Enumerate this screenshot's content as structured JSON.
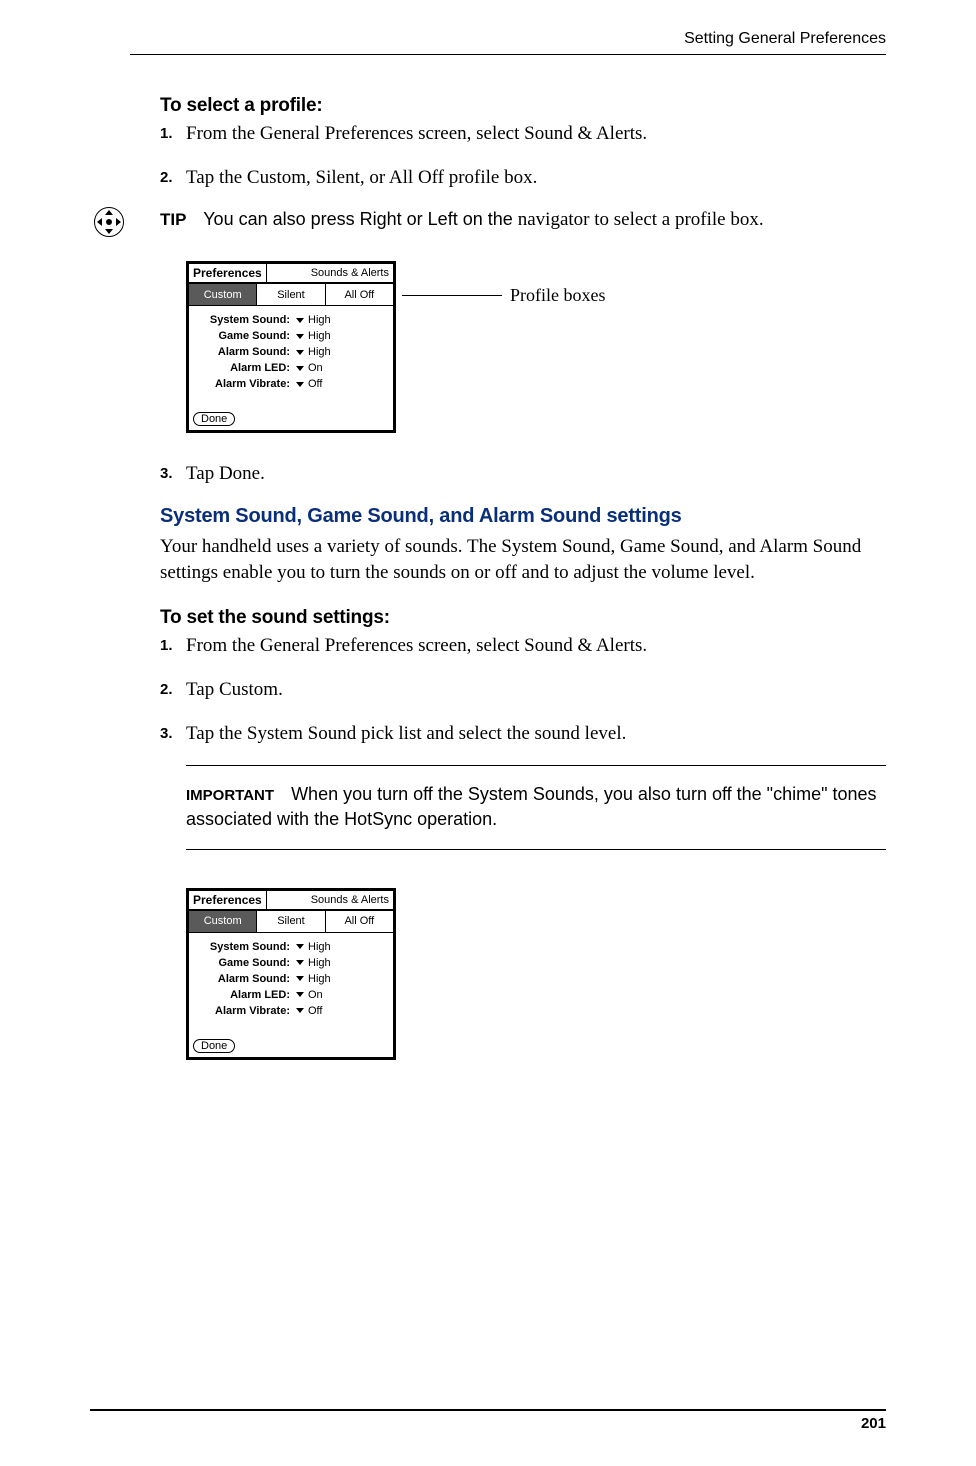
{
  "running_head": "Setting General Preferences",
  "proc1_heading": "To select a profile:",
  "proc1_steps": [
    "From the General Preferences screen, select Sound & Alerts.",
    "Tap the Custom, Silent, or All Off profile box."
  ],
  "tip": {
    "label": "TIP",
    "bold": "You can also press Right or Left on the ",
    "rest": "navigator to select a profile box."
  },
  "mockup": {
    "app_title": "Preferences",
    "screen_title": "Sounds & Alerts",
    "tabs": [
      "Custom",
      "Silent",
      "All Off"
    ],
    "settings": [
      {
        "label": "System Sound:",
        "value": "High"
      },
      {
        "label": "Game Sound:",
        "value": "High"
      },
      {
        "label": "Alarm Sound:",
        "value": "High"
      },
      {
        "label": "Alarm LED:",
        "value": "On"
      },
      {
        "label": "Alarm Vibrate:",
        "value": "Off"
      }
    ],
    "done": "Done"
  },
  "callout": "Profile boxes",
  "proc1_step3": "Tap Done.",
  "section_heading": "System Sound, Game Sound, and Alarm Sound settings",
  "section_para": "Your handheld uses a variety of sounds. The System Sound, Game Sound, and Alarm Sound settings enable you to turn the sounds on or off and to adjust the volume level.",
  "proc2_heading": "To set the sound settings:",
  "proc2_steps": [
    "From the General Preferences screen, select Sound & Alerts.",
    "Tap Custom.",
    "Tap the System Sound pick list and select the sound level."
  ],
  "important": {
    "label": "IMPORTANT",
    "text": "When you turn off the System Sounds, you also turn off the \"chime\" tones associated with the HotSync operation."
  },
  "page_number": "201"
}
